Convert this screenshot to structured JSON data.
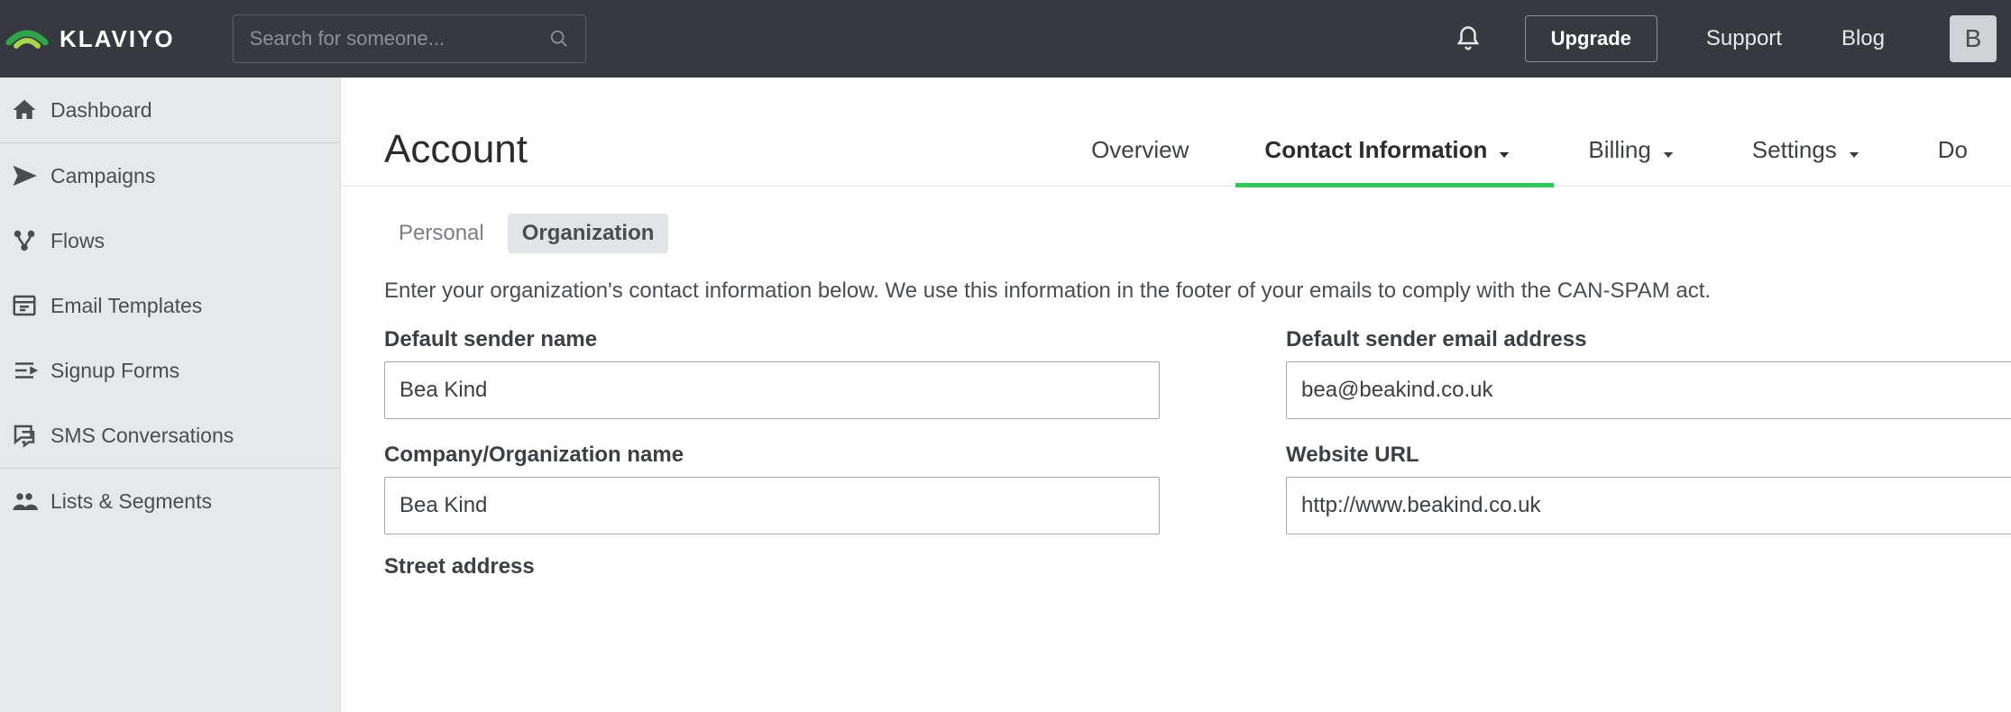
{
  "brand": {
    "name": "KLAVIYO"
  },
  "search": {
    "placeholder": "Search for someone..."
  },
  "top_nav": {
    "upgrade": "Upgrade",
    "support": "Support",
    "blog": "Blog",
    "avatar_initial": "B"
  },
  "sidebar": {
    "items": [
      {
        "label": "Dashboard",
        "icon": "home-icon"
      },
      {
        "label": "Campaigns",
        "icon": "paper-plane-icon"
      },
      {
        "label": "Flows",
        "icon": "flow-icon"
      },
      {
        "label": "Email Templates",
        "icon": "template-icon"
      },
      {
        "label": "Signup Forms",
        "icon": "form-icon"
      },
      {
        "label": "SMS Conversations",
        "icon": "chat-icon"
      },
      {
        "label": "Lists & Segments",
        "icon": "people-icon"
      }
    ]
  },
  "page": {
    "title": "Account",
    "tabs": {
      "overview": "Overview",
      "contact_info": "Contact Information",
      "billing": "Billing",
      "settings": "Settings",
      "extra": "Do"
    },
    "sub_tabs": {
      "personal": "Personal",
      "organization": "Organization"
    },
    "help_text": "Enter your organization's contact information below. We use this information in the footer of your emails to comply with the CAN-SPAM act."
  },
  "form": {
    "sender_name": {
      "label": "Default sender name",
      "value": "Bea Kind"
    },
    "sender_email": {
      "label": "Default sender email address",
      "value": "bea@beakind.co.uk"
    },
    "org_name": {
      "label": "Company/Organization name",
      "value": "Bea Kind"
    },
    "website": {
      "label": "Website URL",
      "value": "http://www.beakind.co.uk"
    },
    "street": {
      "label": "Street address"
    }
  }
}
